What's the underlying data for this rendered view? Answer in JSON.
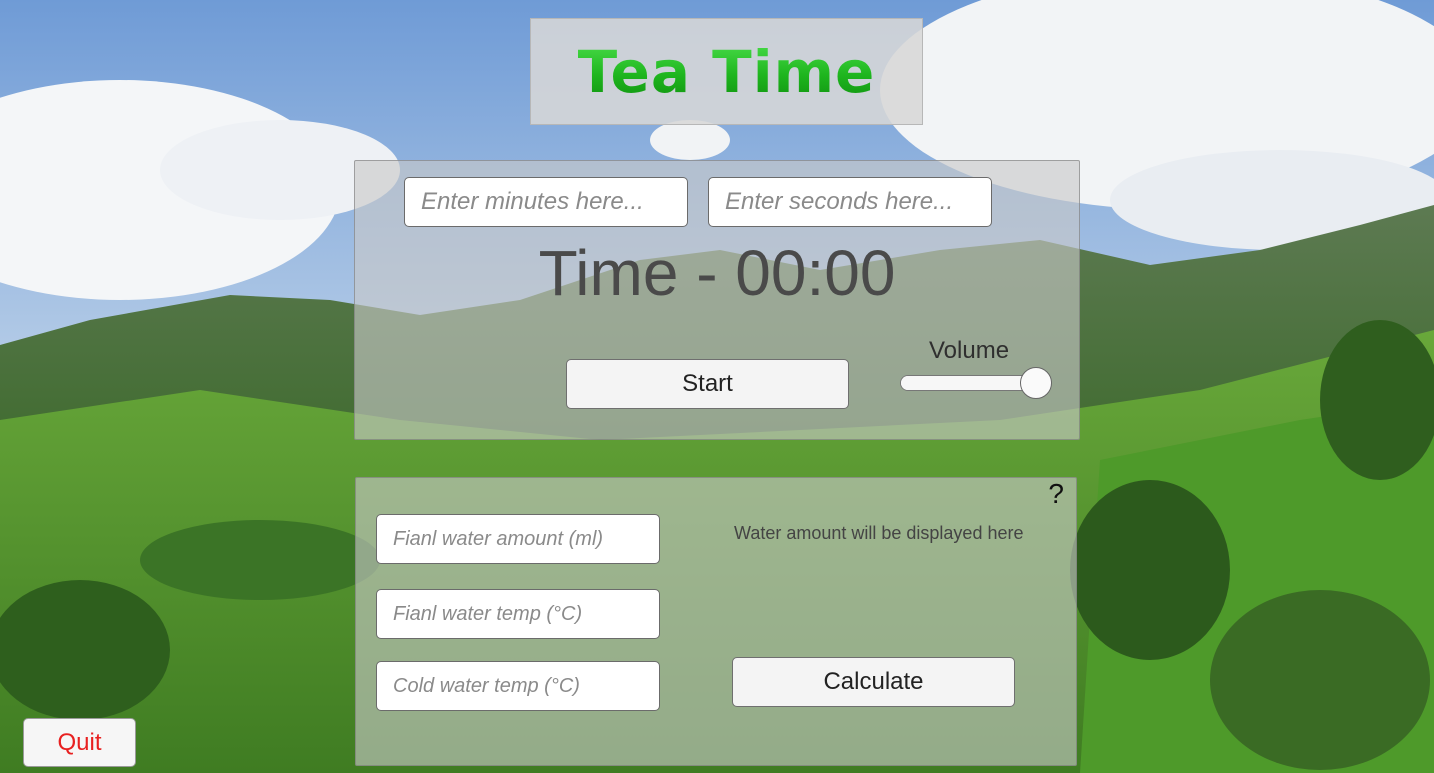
{
  "app": {
    "title": "Tea Time"
  },
  "timer": {
    "minutes_placeholder": "Enter minutes here...",
    "seconds_placeholder": "Enter seconds here...",
    "time_display": "Time - 00:00",
    "start_label": "Start",
    "volume_label": "Volume",
    "volume_level": 1.0
  },
  "calculator": {
    "help_label": "?",
    "final_amount_placeholder": "Fianl water amount (ml)",
    "final_temp_placeholder": "Fianl water temp (°C)",
    "cold_temp_placeholder": "Cold water temp (°C)",
    "water_output_text": "Water amount will be displayed here",
    "calculate_label": "Calculate"
  },
  "quit_label": "Quit",
  "colors": {
    "title_green": "#1eb51e",
    "quit_red": "#e82020",
    "panel_gray": "#c8c8c8"
  }
}
